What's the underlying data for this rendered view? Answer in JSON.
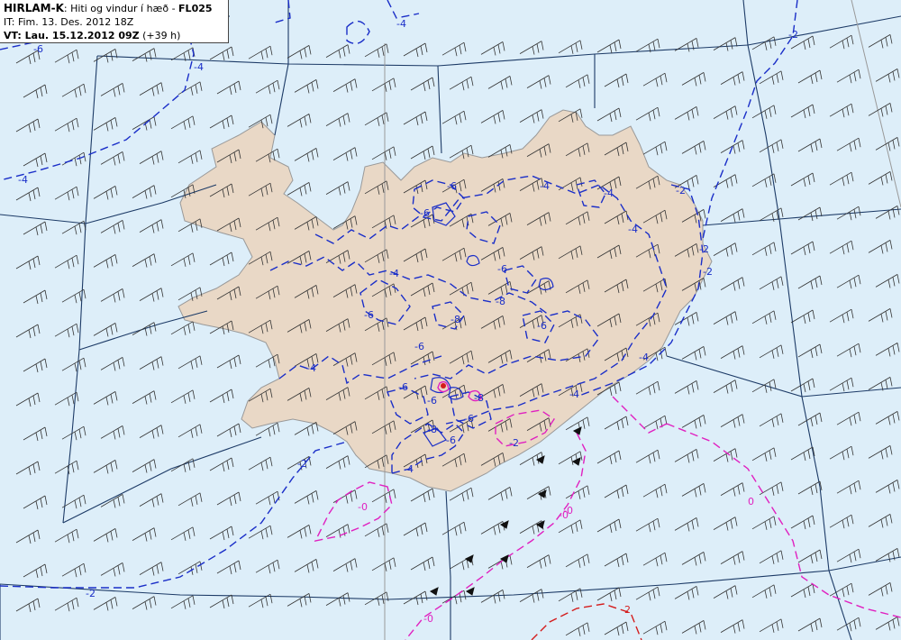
{
  "header": {
    "model": "HIRLAM-K",
    "title_sep": ": ",
    "description": "Hiti og vindur í hæð - ",
    "level": "FL025",
    "it_label": "IT:",
    "it_value": " Fim. 13. Des. 2012 18Z",
    "vt_label": "VT:",
    "vt_value": " Lau. 15.12.2012 09Z",
    "vt_offset": " (+39 h)"
  },
  "map": {
    "colors": {
      "sea": "#ddeef9",
      "land": "#e9d8c6",
      "coast": "#999999",
      "grid": "#1c3a66",
      "meridian": "#999999",
      "contour_negative": "#1a2ec8",
      "contour_zero": "#e020c0",
      "contour_positive": "#d41c1c",
      "barb": "#333333"
    },
    "contour_labels": [
      {
        "text": "-4"
      },
      {
        "text": "-6"
      },
      {
        "text": "-4"
      },
      {
        "text": "-4"
      },
      {
        "text": "-2"
      },
      {
        "text": "-2"
      },
      {
        "text": "-2"
      },
      {
        "text": "-2"
      },
      {
        "text": "-2"
      },
      {
        "text": "-4"
      },
      {
        "text": "-6"
      },
      {
        "text": "-6"
      },
      {
        "text": "-4"
      },
      {
        "text": "-8"
      },
      {
        "text": "-6"
      },
      {
        "text": "-6"
      },
      {
        "text": "-4"
      },
      {
        "text": "-6"
      },
      {
        "text": "-8"
      },
      {
        "text": "-6"
      },
      {
        "text": "-6"
      },
      {
        "text": "-6"
      },
      {
        "text": "-4"
      },
      {
        "text": "-4"
      },
      {
        "text": "-6"
      },
      {
        "text": "-4"
      },
      {
        "text": "-8"
      },
      {
        "text": "-6"
      },
      {
        "text": "-8"
      },
      {
        "text": "-4"
      },
      {
        "text": "-4"
      },
      {
        "text": "-2"
      },
      {
        "text": "-2"
      },
      {
        "text": "-0"
      },
      {
        "text": "-0"
      },
      {
        "text": "-0"
      },
      {
        "text": "0"
      },
      {
        "text": "-0"
      },
      {
        "text": "2"
      }
    ]
  }
}
